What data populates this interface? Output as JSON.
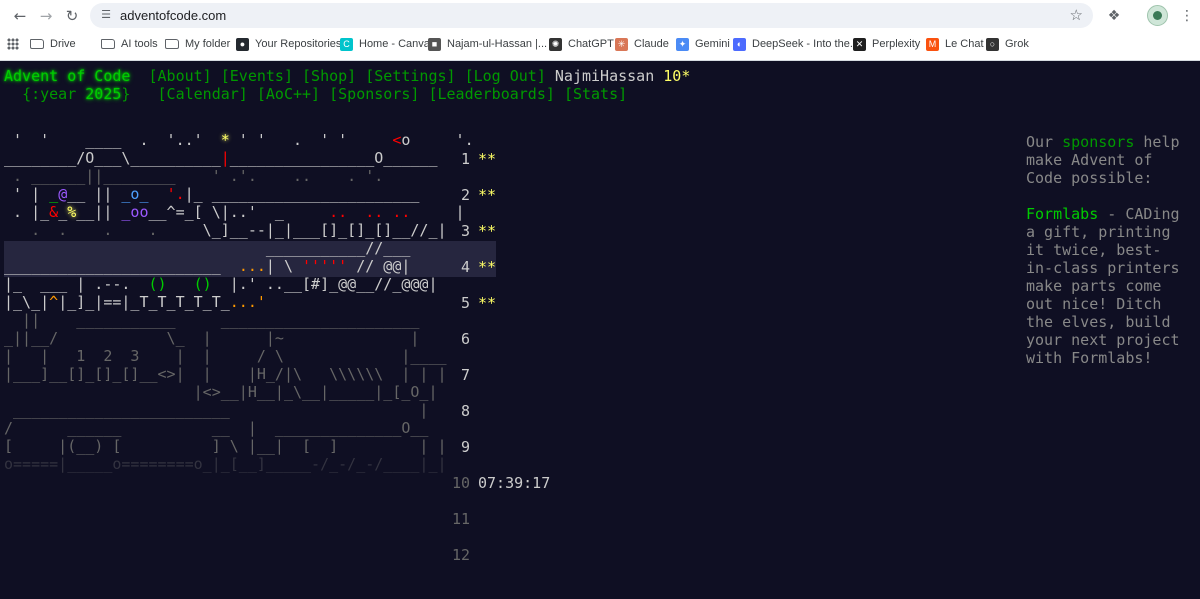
{
  "browser": {
    "url": "adventofcode.com",
    "bookmarks": [
      {
        "label": "Drive",
        "icon": "folder-icon",
        "color": "#5f6368"
      },
      {
        "label": "AI tools",
        "icon": "folder-icon",
        "color": "#5f6368"
      },
      {
        "label": "My folder",
        "icon": "folder-icon",
        "color": "#5f6368"
      },
      {
        "label": "Your Repositories",
        "icon": "github-icon",
        "color": "#24292f"
      },
      {
        "label": "Home - Canva",
        "icon": "canva-icon",
        "color": "#00c4cc"
      },
      {
        "label": "Najam-ul-Hassan |...",
        "icon": "document-icon",
        "color": "#555555"
      },
      {
        "label": "ChatGPT",
        "icon": "chatgpt-icon",
        "color": "#333333"
      },
      {
        "label": "Claude",
        "icon": "claude-icon",
        "color": "#d97757"
      },
      {
        "label": "Gemini",
        "icon": "gemini-icon",
        "color": "#4b8bf5"
      },
      {
        "label": "DeepSeek - Into the...",
        "icon": "deepseek-icon",
        "color": "#4d6bfe"
      },
      {
        "label": "Perplexity",
        "icon": "perplexity-icon",
        "color": "#1f1f1f"
      },
      {
        "label": "Le Chat",
        "icon": "lechat-icon",
        "color": "#fa520f"
      },
      {
        "label": "Grok",
        "icon": "grok-icon",
        "color": "#333333"
      }
    ]
  },
  "header": {
    "logo": "Advent of Code",
    "nav": [
      "[About]",
      "[Events]",
      "[Shop]",
      "[Settings]",
      "[Log Out]"
    ],
    "user": "NajmiHassan",
    "user_stars": "10*",
    "year_prefix": "{:year ",
    "year": "2025",
    "year_suffix": "}",
    "nav2": [
      "[Calendar]",
      "[AoC++]",
      "[Sponsors]",
      "[Leaderboards]",
      "[Stats]"
    ]
  },
  "calendar": {
    "days": [
      {
        "day": "1",
        "stars": "**"
      },
      {
        "day": "2",
        "stars": "**"
      },
      {
        "day": "3",
        "stars": "**"
      },
      {
        "day": "4",
        "stars": "**"
      },
      {
        "day": "5",
        "stars": "**"
      },
      {
        "day": "6",
        "stars": ""
      },
      {
        "day": "7",
        "stars": ""
      },
      {
        "day": "8",
        "stars": ""
      },
      {
        "day": "9",
        "stars": ""
      },
      {
        "day": "10",
        "stars": ""
      },
      {
        "day": "11",
        "stars": ""
      },
      {
        "day": "12",
        "stars": ""
      }
    ],
    "countdown": "07:39:17"
  },
  "sidebar": {
    "intro_before": "Our ",
    "sponsors_link": "sponsors",
    "intro_after": " help make Advent of Code possible:",
    "sponsor_name": "Formlabs",
    "sponsor_text": " - CADing a gift, printing it twice, best-in-class printers make parts come out nice! Ditch the elves, build your next project with Formlabs!"
  }
}
